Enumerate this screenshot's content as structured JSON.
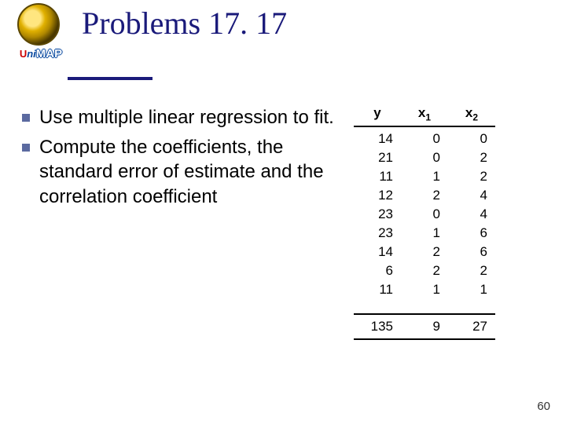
{
  "logo": {
    "brand_prefix": "U",
    "brand_mid": "ni",
    "brand_suffix": "MAP"
  },
  "title": "Problems 17. 17",
  "bullets": [
    "Use multiple linear regression to fit.",
    "Compute the coefficients, the standard error of estimate and the correlation coefficient"
  ],
  "table": {
    "headers": [
      "y",
      "x1",
      "x2"
    ],
    "rows": [
      [
        14,
        0,
        0
      ],
      [
        21,
        0,
        2
      ],
      [
        11,
        1,
        2
      ],
      [
        12,
        2,
        4
      ],
      [
        23,
        0,
        4
      ],
      [
        23,
        1,
        6
      ],
      [
        14,
        2,
        6
      ],
      [
        6,
        2,
        2
      ],
      [
        11,
        1,
        1
      ]
    ],
    "sums": [
      135,
      9,
      27
    ]
  },
  "page_number": "60"
}
